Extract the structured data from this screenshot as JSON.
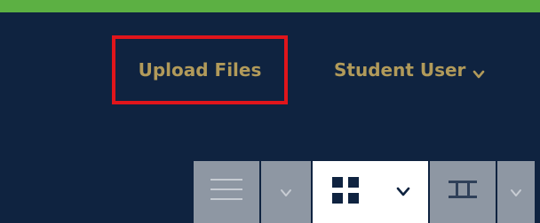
{
  "header": {
    "upload_label": "Upload Files",
    "user_label": "Student User",
    "user_chevron_icon": "chevron-down-icon"
  },
  "view_toolbar": {
    "buttons": [
      {
        "icon": "list-view-icon",
        "state": "inactive"
      },
      {
        "icon": "chevron-down-icon",
        "state": "inactive"
      },
      {
        "icon": "grid-view-icon",
        "state": "active"
      },
      {
        "icon": "chevron-down-icon",
        "state": "active"
      },
      {
        "icon": "column-view-icon",
        "state": "inactive"
      },
      {
        "icon": "chevron-down-icon",
        "state": "inactive"
      }
    ]
  },
  "colors": {
    "background": "#0f2340",
    "top_stripe": "#5cb043",
    "gold_text": "#b19a5a",
    "highlight_border": "#e0151b",
    "toolbar_inactive": "#8e97a3",
    "toolbar_active": "#ffffff",
    "icon_inactive": "#c7ccd3",
    "icon_active": "#0f2340"
  }
}
